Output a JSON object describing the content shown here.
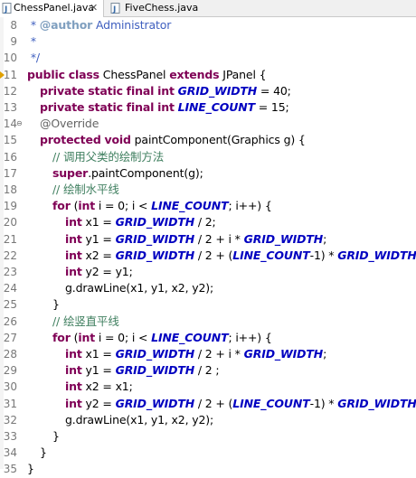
{
  "tabs": [
    {
      "label": "ChessPanel.java",
      "active": true,
      "closable": true
    },
    {
      "label": "FiveChess.java",
      "active": false,
      "closable": false
    }
  ],
  "colors": {
    "keyword": "#7f0055",
    "constant": "#0000c0",
    "comment": "#3f7f5f",
    "javadoc": "#3f5fbf",
    "annotation": "#646464",
    "line_number": "#787878"
  },
  "lines": [
    {
      "n": "8",
      "indent": 0,
      "tokens": [
        {
          "t": " * ",
          "c": "cmdoc"
        },
        {
          "t": "@author",
          "c": "cmtag"
        },
        {
          "t": " Administrator",
          "c": "cmdoc"
        }
      ]
    },
    {
      "n": "9",
      "indent": 0,
      "tokens": [
        {
          "t": " *",
          "c": "cmdoc"
        }
      ]
    },
    {
      "n": "10",
      "indent": 0,
      "tokens": [
        {
          "t": " */",
          "c": "cmdoc"
        }
      ]
    },
    {
      "n": "11",
      "indent": 0,
      "warn": true,
      "tokens": [
        {
          "t": "public",
          "c": "kw"
        },
        {
          "t": " "
        },
        {
          "t": "class",
          "c": "kw"
        },
        {
          "t": " ChessPanel "
        },
        {
          "t": "extends",
          "c": "kw"
        },
        {
          "t": " JPanel {"
        }
      ]
    },
    {
      "n": "12",
      "indent": 1,
      "tokens": [
        {
          "t": "private",
          "c": "kw"
        },
        {
          "t": " "
        },
        {
          "t": "static",
          "c": "kw"
        },
        {
          "t": " "
        },
        {
          "t": "final",
          "c": "kw"
        },
        {
          "t": " "
        },
        {
          "t": "int",
          "c": "kw"
        },
        {
          "t": " "
        },
        {
          "t": "GRID_WIDTH",
          "c": "const"
        },
        {
          "t": " = 40;"
        }
      ]
    },
    {
      "n": "13",
      "indent": 1,
      "tokens": [
        {
          "t": "private",
          "c": "kw"
        },
        {
          "t": " "
        },
        {
          "t": "static",
          "c": "kw"
        },
        {
          "t": " "
        },
        {
          "t": "final",
          "c": "kw"
        },
        {
          "t": " "
        },
        {
          "t": "int",
          "c": "kw"
        },
        {
          "t": " "
        },
        {
          "t": "LINE_COUNT",
          "c": "const"
        },
        {
          "t": " = 15;"
        }
      ]
    },
    {
      "n": "14",
      "indent": 1,
      "fold": true,
      "tokens": [
        {
          "t": "@Override",
          "c": "ann"
        }
      ]
    },
    {
      "n": "15",
      "indent": 1,
      "tokens": [
        {
          "t": "protected",
          "c": "kw"
        },
        {
          "t": " "
        },
        {
          "t": "void",
          "c": "kw"
        },
        {
          "t": " paintComponent(Graphics g) {"
        }
      ]
    },
    {
      "n": "16",
      "indent": 2,
      "tokens": [
        {
          "t": "// 调用父类的绘制方法",
          "c": "cm"
        }
      ]
    },
    {
      "n": "17",
      "indent": 2,
      "tokens": [
        {
          "t": "super",
          "c": "kw"
        },
        {
          "t": ".paintComponent(g);"
        }
      ]
    },
    {
      "n": "18",
      "indent": 2,
      "tokens": [
        {
          "t": "// 绘制水平线",
          "c": "cm"
        }
      ]
    },
    {
      "n": "19",
      "indent": 2,
      "tokens": [
        {
          "t": "for",
          "c": "kw"
        },
        {
          "t": " ("
        },
        {
          "t": "int",
          "c": "kw"
        },
        {
          "t": " i = 0; i < "
        },
        {
          "t": "LINE_COUNT",
          "c": "const"
        },
        {
          "t": "; i++) {"
        }
      ]
    },
    {
      "n": "20",
      "indent": 3,
      "tokens": [
        {
          "t": "int",
          "c": "kw"
        },
        {
          "t": " x1 = "
        },
        {
          "t": "GRID_WIDTH",
          "c": "const"
        },
        {
          "t": " / 2;"
        }
      ]
    },
    {
      "n": "21",
      "indent": 3,
      "tokens": [
        {
          "t": "int",
          "c": "kw"
        },
        {
          "t": " y1 = "
        },
        {
          "t": "GRID_WIDTH",
          "c": "const"
        },
        {
          "t": " / 2 + i * "
        },
        {
          "t": "GRID_WIDTH",
          "c": "const"
        },
        {
          "t": ";"
        }
      ]
    },
    {
      "n": "22",
      "indent": 3,
      "tokens": [
        {
          "t": "int",
          "c": "kw"
        },
        {
          "t": " x2 = "
        },
        {
          "t": "GRID_WIDTH",
          "c": "const"
        },
        {
          "t": " / 2 + ("
        },
        {
          "t": "LINE_COUNT",
          "c": "const"
        },
        {
          "t": "-1) * "
        },
        {
          "t": "GRID_WIDTH",
          "c": "const"
        },
        {
          "t": ";"
        }
      ]
    },
    {
      "n": "23",
      "indent": 3,
      "tokens": [
        {
          "t": "int",
          "c": "kw"
        },
        {
          "t": " y2 = y1;"
        }
      ]
    },
    {
      "n": "24",
      "indent": 3,
      "tokens": [
        {
          "t": "g.drawLine(x1, y1, x2, y2);"
        }
      ]
    },
    {
      "n": "25",
      "indent": 2,
      "tokens": [
        {
          "t": "}"
        }
      ]
    },
    {
      "n": "26",
      "indent": 2,
      "tokens": [
        {
          "t": "// 绘竖直平线",
          "c": "cm"
        }
      ]
    },
    {
      "n": "27",
      "indent": 2,
      "tokens": [
        {
          "t": "for",
          "c": "kw"
        },
        {
          "t": " ("
        },
        {
          "t": "int",
          "c": "kw"
        },
        {
          "t": " i = 0; i < "
        },
        {
          "t": "LINE_COUNT",
          "c": "const"
        },
        {
          "t": "; i++) {"
        }
      ]
    },
    {
      "n": "28",
      "indent": 3,
      "tokens": [
        {
          "t": "int",
          "c": "kw"
        },
        {
          "t": " x1 = "
        },
        {
          "t": "GRID_WIDTH",
          "c": "const"
        },
        {
          "t": " / 2 + i * "
        },
        {
          "t": "GRID_WIDTH",
          "c": "const"
        },
        {
          "t": ";"
        }
      ]
    },
    {
      "n": "29",
      "indent": 3,
      "tokens": [
        {
          "t": "int",
          "c": "kw"
        },
        {
          "t": " y1 = "
        },
        {
          "t": "GRID_WIDTH",
          "c": "const"
        },
        {
          "t": " / 2 ;"
        }
      ]
    },
    {
      "n": "30",
      "indent": 3,
      "tokens": [
        {
          "t": "int",
          "c": "kw"
        },
        {
          "t": " x2 = x1;"
        }
      ]
    },
    {
      "n": "31",
      "indent": 3,
      "tokens": [
        {
          "t": "int",
          "c": "kw"
        },
        {
          "t": " y2 = "
        },
        {
          "t": "GRID_WIDTH",
          "c": "const"
        },
        {
          "t": " / 2 + ("
        },
        {
          "t": "LINE_COUNT",
          "c": "const"
        },
        {
          "t": "-1) * "
        },
        {
          "t": "GRID_WIDTH",
          "c": "const"
        },
        {
          "t": ";"
        }
      ]
    },
    {
      "n": "32",
      "indent": 3,
      "tokens": [
        {
          "t": "g.drawLine(x1, y1, x2, y2);"
        }
      ]
    },
    {
      "n": "33",
      "indent": 2,
      "tokens": [
        {
          "t": "}"
        }
      ]
    },
    {
      "n": "34",
      "indent": 1,
      "tokens": [
        {
          "t": "}"
        }
      ]
    },
    {
      "n": "35",
      "indent": 0,
      "tokens": [
        {
          "t": "}"
        }
      ]
    }
  ]
}
